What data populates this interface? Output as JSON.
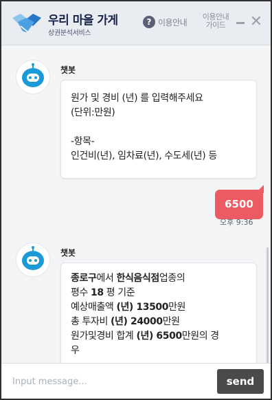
{
  "header": {
    "title": "우리 마을 가게",
    "subtitle": "상권분석서비스",
    "help_label": "이용안내",
    "guide_label": "이용안내\n가이드",
    "min_icon": "minus-icon",
    "close_icon": "close-icon"
  },
  "messages": [
    {
      "sender": "챗봇",
      "lines": [
        "원가 및 경비 (년) 를 입력해주세요",
        "(단위:만원)",
        "",
        "-항목-",
        "인건비(년), 임차료(년), 수도세(년) 등"
      ]
    },
    {
      "user_value": "6500",
      "time": "오후 9:36"
    },
    {
      "sender": "챗봇",
      "line1_a": "종로구",
      "line1_b": "에서 ",
      "line1_c": "한식음식점",
      "line1_d": "업종의",
      "line2_a": "평수 ",
      "line2_b": "18",
      "line2_c": " 평 기준",
      "line3_a": "예상매출액 ",
      "line3_b": "(년) 13500",
      "line3_c": "만원",
      "line4_a": "총 투자비 ",
      "line4_b": "(년) 24000",
      "line4_c": "만원",
      "line5_a": "원가및경비 합계 ",
      "line5_b": "(년) 6500",
      "line5_c": "만원의 경",
      "line6": "우"
    }
  ],
  "input": {
    "placeholder": "Input message...",
    "send_label": "send"
  },
  "colors": {
    "user_bubble": "#eb5b61",
    "header_bg": "#e9ecf1",
    "send_button": "#4a4a4a",
    "bot_avatar": "#1a9bd8"
  }
}
